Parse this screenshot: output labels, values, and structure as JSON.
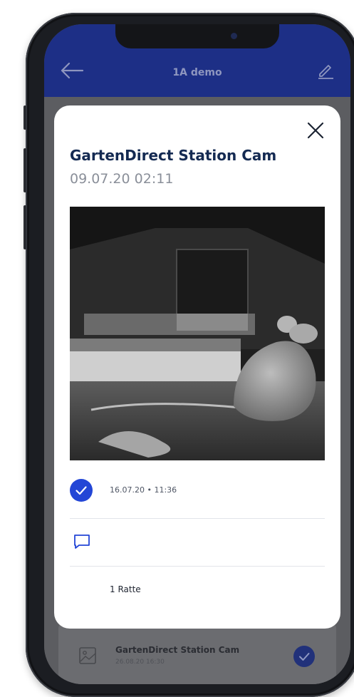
{
  "header": {
    "title": "1A demo"
  },
  "modal": {
    "title": "GartenDirect Station Cam",
    "timestamp": "09.07.20 02:11",
    "check_entry": {
      "datetime": "16.07.20 • 11:36"
    },
    "note": "1 Ratte"
  },
  "background_list": {
    "item": {
      "title": "GartenDirect Station Cam",
      "datetime": "26.08.20 16:30"
    }
  },
  "icons": {
    "back": "arrow-left-icon",
    "edit": "pencil-icon",
    "close": "close-icon",
    "check": "check-circle-icon",
    "comment": "comment-icon",
    "image": "image-icon"
  },
  "colors": {
    "header": "#1d2f86",
    "accent": "#2346d6",
    "title": "#142a52"
  }
}
